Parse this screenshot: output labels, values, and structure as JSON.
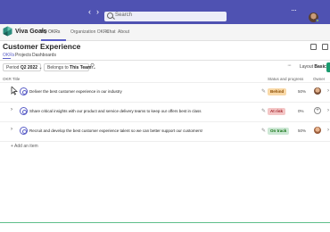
{
  "titlebar": {
    "search_placeholder": "Search",
    "nav_back": "‹",
    "nav_forward": "›",
    "more": "···"
  },
  "appbar": {
    "app_name": "Viva Goals",
    "tabs": [
      "My OKRs",
      "Organization OKRs",
      "Chat",
      "About"
    ],
    "active_tab": "My OKRs"
  },
  "page": {
    "title": "Customer Experience",
    "subtabs": [
      "OKRs",
      "Projects",
      "Dashboards"
    ],
    "active_subtab": "OKRs"
  },
  "filters": {
    "period_label": "Period",
    "period_value": "Q2 2022",
    "belongs_label": "Belongs to",
    "belongs_value": "This Team",
    "layout_label": "Layout",
    "layout_value": "Basic"
  },
  "columns": {
    "title": "OKR Title",
    "status": "Status and progress",
    "owner": "Owner"
  },
  "rows": [
    {
      "title": "Deliver the best customer experience in our industry",
      "status": "Behind",
      "status_color": "#f9d9a8",
      "status_text_color": "#8a4b00",
      "progress": "50%",
      "owner": "avatar"
    },
    {
      "title": "Share critical insights with our product and service delivery teams to keep our offers best in class",
      "status": "At risk",
      "status_color": "#f4c6c6",
      "status_text_color": "#a4262c",
      "progress": "0%",
      "owner": "add"
    },
    {
      "title": "Recruit and develop the best customer experience talent so we can better support our customers!",
      "status": "On track",
      "status_color": "#cde8d5",
      "status_text_color": "#0e700e",
      "progress": "50%",
      "owner": "avatar"
    }
  ],
  "add_item": "+ Add an item",
  "colors": {
    "accent": "#5b5fc7",
    "titlebar": "#4f52b2",
    "primary_button": "#1a9b6f"
  }
}
